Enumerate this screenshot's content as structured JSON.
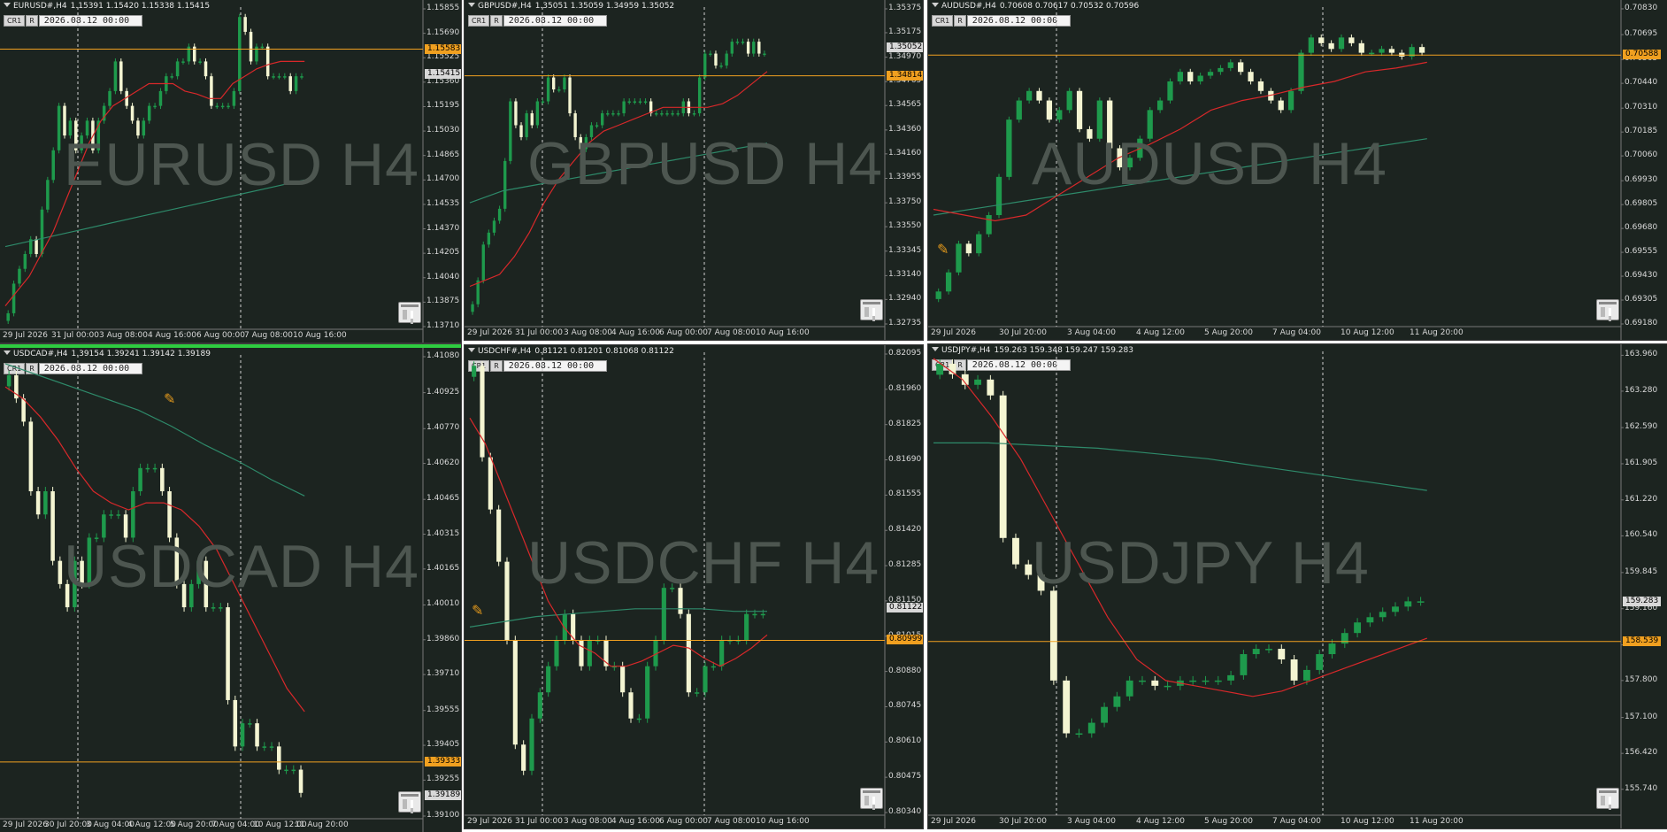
{
  "date_box": "2026.08.12 00:00",
  "btn_cr1": "CR1",
  "btn_r": "R",
  "colors": {
    "bg": "#1c2420",
    "bull": "#1e9a4c",
    "bear": "#f4f5d2",
    "ma_fast": "#d8282a",
    "ma_slow": "#2e8a6a",
    "hline": "#f0a020",
    "axis": "#d8d8d8"
  },
  "charts": [
    {
      "symbol": "EURUSD#,H4",
      "ohlc": "1.15391 1.15420 1.15338 1.15415",
      "watermark": "EURUSD H4",
      "yticks": [
        "1.15855",
        "1.15690",
        "1.15525",
        "1.15360",
        "1.15195",
        "1.15030",
        "1.14865",
        "1.14700",
        "1.14535",
        "1.14370",
        "1.14205",
        "1.14040",
        "1.13875",
        "1.13710"
      ],
      "ymax": 1.15855,
      "ymin": 1.1371,
      "hline": 1.15583,
      "hline_label": "1.15583",
      "cur": 1.15415,
      "cur_label": "1.15415",
      "times": [
        "29 Jul 2026",
        "31 Jul 00:00",
        "3 Aug 08:00",
        "4 Aug 16:00",
        "6 Aug 00:00",
        "7 Aug 08:00",
        "10 Aug 16:00"
      ],
      "bars": [
        1.138,
        1.14,
        1.141,
        1.142,
        1.143,
        1.142,
        1.145,
        1.147,
        1.149,
        1.152,
        1.15,
        1.151,
        1.149,
        1.15,
        1.151,
        1.149,
        1.151,
        1.152,
        1.153,
        1.155,
        1.153,
        1.152,
        1.151,
        1.15,
        1.151,
        1.152,
        1.152,
        1.153,
        1.154,
        1.154,
        1.155,
        1.155,
        1.156,
        1.155,
        1.155,
        1.154,
        1.152,
        1.152,
        1.152,
        1.152,
        1.153,
        1.158,
        1.157,
        1.155,
        1.156,
        1.156,
        1.154,
        1.154,
        1.154,
        1.154,
        1.153,
        1.154,
        1.154
      ],
      "ma_fast": [
        1.1385,
        1.1395,
        1.1405,
        1.142,
        1.1435,
        1.1455,
        1.1475,
        1.1495,
        1.151,
        1.152,
        1.1525,
        1.153,
        1.1535,
        1.1535,
        1.1535,
        1.153,
        1.1528,
        1.1525,
        1.1525,
        1.1535,
        1.154,
        1.1545,
        1.1548,
        1.155,
        1.155,
        1.155
      ],
      "ma_slow": [
        1.1425,
        1.143,
        1.1435,
        1.144,
        1.1445,
        1.145,
        1.1455,
        1.146,
        1.1465,
        1.147
      ]
    },
    {
      "symbol": "GBPUSD#,H4",
      "ohlc": "1.35051 1.35059 1.34959 1.35052",
      "watermark": "GBPUSD H4",
      "yticks": [
        "1.35375",
        "1.35175",
        "1.34970",
        "1.34765",
        "1.34565",
        "1.34360",
        "1.34160",
        "1.33955",
        "1.33750",
        "1.33550",
        "1.33345",
        "1.33140",
        "1.32940",
        "1.32735"
      ],
      "ymax": 1.35375,
      "ymin": 1.32735,
      "hline": 1.34814,
      "hline_label": "1.34814",
      "cur": 1.35052,
      "cur_label": "1.35052",
      "times": [
        "29 Jul 2026",
        "31 Jul 00:00",
        "3 Aug 08:00",
        "4 Aug 16:00",
        "6 Aug 00:00",
        "7 Aug 08:00",
        "10 Aug 16:00"
      ],
      "bars": [
        1.329,
        1.331,
        1.334,
        1.335,
        1.336,
        1.337,
        1.341,
        1.346,
        1.344,
        1.343,
        1.345,
        1.344,
        1.346,
        1.346,
        1.348,
        1.347,
        1.347,
        1.348,
        1.345,
        1.343,
        1.342,
        1.343,
        1.344,
        1.344,
        1.345,
        1.345,
        1.345,
        1.345,
        1.346,
        1.346,
        1.346,
        1.346,
        1.346,
        1.345,
        1.345,
        1.345,
        1.345,
        1.345,
        1.345,
        1.346,
        1.345,
        1.345,
        1.348,
        1.35,
        1.35,
        1.349,
        1.349,
        1.35,
        1.351,
        1.351,
        1.351,
        1.35,
        1.351,
        1.35,
        1.35
      ],
      "ma_fast": [
        1.3305,
        1.331,
        1.3315,
        1.333,
        1.335,
        1.3375,
        1.3395,
        1.341,
        1.3425,
        1.3435,
        1.344,
        1.3445,
        1.345,
        1.3455,
        1.3455,
        1.3455,
        1.3455,
        1.3458,
        1.3465,
        1.3475,
        1.3485
      ],
      "ma_slow": [
        1.3375,
        1.3385,
        1.339,
        1.3395,
        1.34,
        1.3405,
        1.341,
        1.3415,
        1.342,
        1.3425
      ]
    },
    {
      "symbol": "AUDUSD#,H4",
      "ohlc": "0.70608 0.70617 0.70532 0.70596",
      "watermark": "AUDUSD H4",
      "yticks": [
        "0.70830",
        "0.70695",
        "0.70565",
        "0.70440",
        "0.70310",
        "0.70185",
        "0.70060",
        "0.69930",
        "0.69805",
        "0.69680",
        "0.69555",
        "0.69430",
        "0.69305",
        "0.69180"
      ],
      "ymax": 0.7083,
      "ymin": 0.6918,
      "hline": 0.70588,
      "hline_label": "0.70588",
      "cur": 0.70596,
      "cur_label": "",
      "times": [
        "29 Jul 2026",
        "30 Jul 20:00",
        "3 Aug 04:00",
        "4 Aug 12:00",
        "5 Aug 20:00",
        "7 Aug 04:00",
        "10 Aug 12:00",
        "11 Aug 20:00"
      ],
      "bars": [
        0.6935,
        0.6945,
        0.696,
        0.6955,
        0.6965,
        0.6975,
        0.6995,
        0.7025,
        0.7035,
        0.704,
        0.7035,
        0.7025,
        0.703,
        0.704,
        0.702,
        0.7015,
        0.7035,
        0.701,
        0.7,
        0.7005,
        0.7015,
        0.703,
        0.7035,
        0.7045,
        0.705,
        0.7045,
        0.7048,
        0.705,
        0.7052,
        0.7055,
        0.705,
        0.7045,
        0.704,
        0.7035,
        0.703,
        0.704,
        0.706,
        0.7068,
        0.7065,
        0.7062,
        0.7068,
        0.7065,
        0.706,
        0.706,
        0.7062,
        0.706,
        0.7058,
        0.7063,
        0.706
      ],
      "ma_fast": [
        0.6978,
        0.6975,
        0.6972,
        0.6975,
        0.6985,
        0.6995,
        0.7005,
        0.7012,
        0.702,
        0.703,
        0.7035,
        0.7038,
        0.7042,
        0.7045,
        0.705,
        0.7052,
        0.7055
      ],
      "ma_slow": [
        0.6975,
        0.698,
        0.6985,
        0.699,
        0.6995,
        0.7,
        0.7005,
        0.701,
        0.7015
      ]
    },
    {
      "symbol": "USDCAD#,H4",
      "ohlc": "1.39154 1.39241 1.39142 1.39189",
      "watermark": "USDCAD H4",
      "yticks": [
        "1.41080",
        "1.40925",
        "1.40770",
        "1.40620",
        "1.40465",
        "1.40315",
        "1.40165",
        "1.40010",
        "1.39860",
        "1.39710",
        "1.39555",
        "1.39405",
        "1.39255",
        "1.39100"
      ],
      "ymax": 1.4108,
      "ymin": 1.391,
      "hline": 1.39333,
      "hline_label": "1.39333",
      "cur": 1.39189,
      "cur_label": "1.39189",
      "times": [
        "29 Jul 2026",
        "30 Jul 20:00",
        "3 Aug 04:00",
        "4 Aug 12:00",
        "5 Aug 20:00",
        "7 Aug 04:00",
        "10 Aug 12:00",
        "11 Aug 20:00"
      ],
      "bars": [
        1.41,
        1.409,
        1.408,
        1.405,
        1.404,
        1.405,
        1.402,
        1.401,
        1.4,
        1.402,
        1.401,
        1.403,
        1.403,
        1.404,
        1.404,
        1.404,
        1.403,
        1.405,
        1.406,
        1.406,
        1.406,
        1.405,
        1.403,
        1.401,
        1.4,
        1.401,
        1.402,
        1.4,
        1.4,
        1.4,
        1.396,
        1.394,
        1.395,
        1.395,
        1.394,
        1.394,
        1.394,
        1.393,
        1.393,
        1.393,
        1.392
      ],
      "ma_fast": [
        1.4095,
        1.409,
        1.4082,
        1.4072,
        1.406,
        1.405,
        1.4045,
        1.4042,
        1.4045,
        1.4045,
        1.4042,
        1.4035,
        1.4025,
        1.401,
        1.3995,
        1.398,
        1.3965,
        1.3955
      ],
      "ma_slow": [
        1.4105,
        1.41,
        1.4095,
        1.409,
        1.4085,
        1.4078,
        1.407,
        1.4063,
        1.4055,
        1.4048
      ]
    },
    {
      "symbol": "USDCHF#,H4",
      "ohlc": "0.81121 0.81201 0.81068 0.81122",
      "watermark": "USDCHF H4",
      "yticks": [
        "0.82095",
        "0.81960",
        "0.81825",
        "0.81690",
        "0.81555",
        "0.81420",
        "0.81285",
        "0.81150",
        "0.81015",
        "0.80880",
        "0.80745",
        "0.80610",
        "0.80475",
        "0.80340"
      ],
      "ymax": 0.82095,
      "ymin": 0.8034,
      "hline": 0.80999,
      "hline_label": "0.80999",
      "cur": 0.81122,
      "cur_label": "0.81122",
      "times": [
        "29 Jul 2026",
        "31 Jul 00:00",
        "3 Aug 08:00",
        "4 Aug 16:00",
        "6 Aug 00:00",
        "7 Aug 08:00",
        "10 Aug 16:00"
      ],
      "bars": [
        0.8205,
        0.817,
        0.815,
        0.813,
        0.81,
        0.806,
        0.805,
        0.807,
        0.808,
        0.809,
        0.81,
        0.811,
        0.81,
        0.809,
        0.81,
        0.81,
        0.809,
        0.809,
        0.808,
        0.807,
        0.807,
        0.809,
        0.81,
        0.812,
        0.812,
        0.811,
        0.808,
        0.808,
        0.809,
        0.809,
        0.81,
        0.81,
        0.81,
        0.811,
        0.811,
        0.811
      ],
      "ma_fast": [
        0.8185,
        0.8175,
        0.816,
        0.8145,
        0.813,
        0.8115,
        0.8105,
        0.8098,
        0.8095,
        0.809,
        0.809,
        0.8092,
        0.8095,
        0.8098,
        0.8097,
        0.8093,
        0.809,
        0.8093,
        0.8097,
        0.8102
      ],
      "ma_slow": [
        0.8105,
        0.8107,
        0.8109,
        0.811,
        0.8111,
        0.8112,
        0.8112,
        0.8112,
        0.8111,
        0.8111
      ]
    },
    {
      "symbol": "USDJPY#,H4",
      "ohlc": "159.263 159.348 159.247 159.283",
      "watermark": "USDJPY H4",
      "yticks": [
        "163.960",
        "163.280",
        "162.590",
        "161.905",
        "161.220",
        "160.540",
        "159.845",
        "159.160",
        "158.475",
        "157.800",
        "157.100",
        "156.420",
        "155.740"
      ],
      "ymax": 164.0,
      "ymin": 155.3,
      "hline": 158.539,
      "hline_label": "158.539",
      "cur": 159.283,
      "cur_label": "159.283",
      "times": [
        "29 Jul 2026",
        "30 Jul 20:00",
        "3 Aug 04:00",
        "4 Aug 12:00",
        "5 Aug 20:00",
        "7 Aug 04:00",
        "10 Aug 12:00",
        "11 Aug 20:00"
      ],
      "bars": [
        163.8,
        163.6,
        163.4,
        163.5,
        163.2,
        160.5,
        160.0,
        159.8,
        159.5,
        157.8,
        156.8,
        156.8,
        157.0,
        157.3,
        157.5,
        157.8,
        157.8,
        157.7,
        157.7,
        157.8,
        157.8,
        157.8,
        157.8,
        157.9,
        158.3,
        158.4,
        158.4,
        158.2,
        157.8,
        158.0,
        158.3,
        158.5,
        158.7,
        158.9,
        159.0,
        159.1,
        159.2,
        159.3,
        159.3
      ],
      "ma_fast": [
        163.9,
        163.5,
        162.8,
        162.0,
        161.0,
        160.0,
        159.0,
        158.2,
        157.8,
        157.7,
        157.6,
        157.5,
        157.6,
        157.8,
        158.0,
        158.2,
        158.4,
        158.6
      ],
      "ma_slow": [
        162.3,
        162.3,
        162.25,
        162.2,
        162.1,
        162.0,
        161.85,
        161.7,
        161.55,
        161.4
      ]
    }
  ]
}
